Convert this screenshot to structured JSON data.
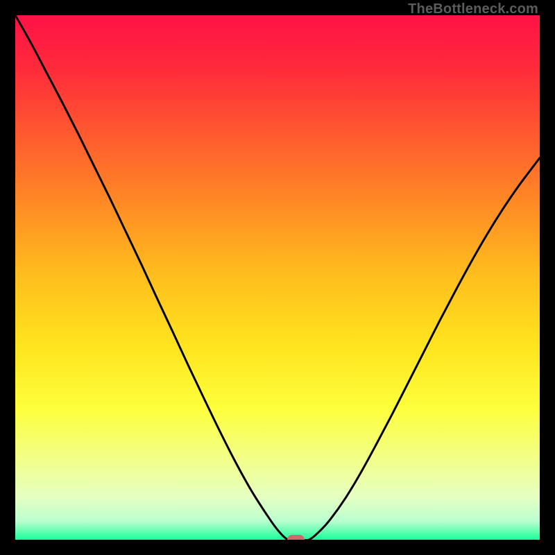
{
  "watermark": "TheBottleneck.com",
  "accent_marker_color": "#cc6b6c",
  "curve_color": "#000000",
  "gradient_stops": [
    {
      "offset": 0.0,
      "color": "#ff1246"
    },
    {
      "offset": 0.1,
      "color": "#ff2a3b"
    },
    {
      "offset": 0.22,
      "color": "#ff5730"
    },
    {
      "offset": 0.35,
      "color": "#ff8725"
    },
    {
      "offset": 0.5,
      "color": "#ffbf1d"
    },
    {
      "offset": 0.63,
      "color": "#ffe41e"
    },
    {
      "offset": 0.75,
      "color": "#fdff3c"
    },
    {
      "offset": 0.85,
      "color": "#f2ff8c"
    },
    {
      "offset": 0.92,
      "color": "#e5ffc3"
    },
    {
      "offset": 0.965,
      "color": "#b8ffcf"
    },
    {
      "offset": 0.985,
      "color": "#5fffb0"
    },
    {
      "offset": 1.0,
      "color": "#17ff9a"
    }
  ],
  "chart_data": {
    "type": "line",
    "title": "",
    "xlabel": "",
    "ylabel": "",
    "xlim": [
      0,
      100
    ],
    "ylim": [
      0,
      100
    ],
    "x": [
      0,
      3,
      6,
      9,
      12,
      15,
      18,
      21,
      24,
      27,
      30,
      33,
      36,
      39,
      42,
      45,
      48,
      50,
      52,
      54,
      56,
      58,
      60,
      63,
      66,
      69,
      72,
      75,
      78,
      81,
      84,
      87,
      90,
      93,
      96,
      100
    ],
    "values": [
      100,
      94.7,
      89,
      83.3,
      77.4,
      71.3,
      65.2,
      58.9,
      52.6,
      46.1,
      39.7,
      33.2,
      26.9,
      20.7,
      14.8,
      9.4,
      4.7,
      1.9,
      0,
      0,
      0,
      1.6,
      3.8,
      8,
      13,
      18.5,
      24.2,
      30.1,
      36,
      41.9,
      47.6,
      53.1,
      58.3,
      63.1,
      67.5,
      72.8
    ],
    "marker": {
      "x": 53.5,
      "y": 0,
      "width_frac": 0.033,
      "height_frac": 0.019
    },
    "grid": false,
    "legend": false
  }
}
